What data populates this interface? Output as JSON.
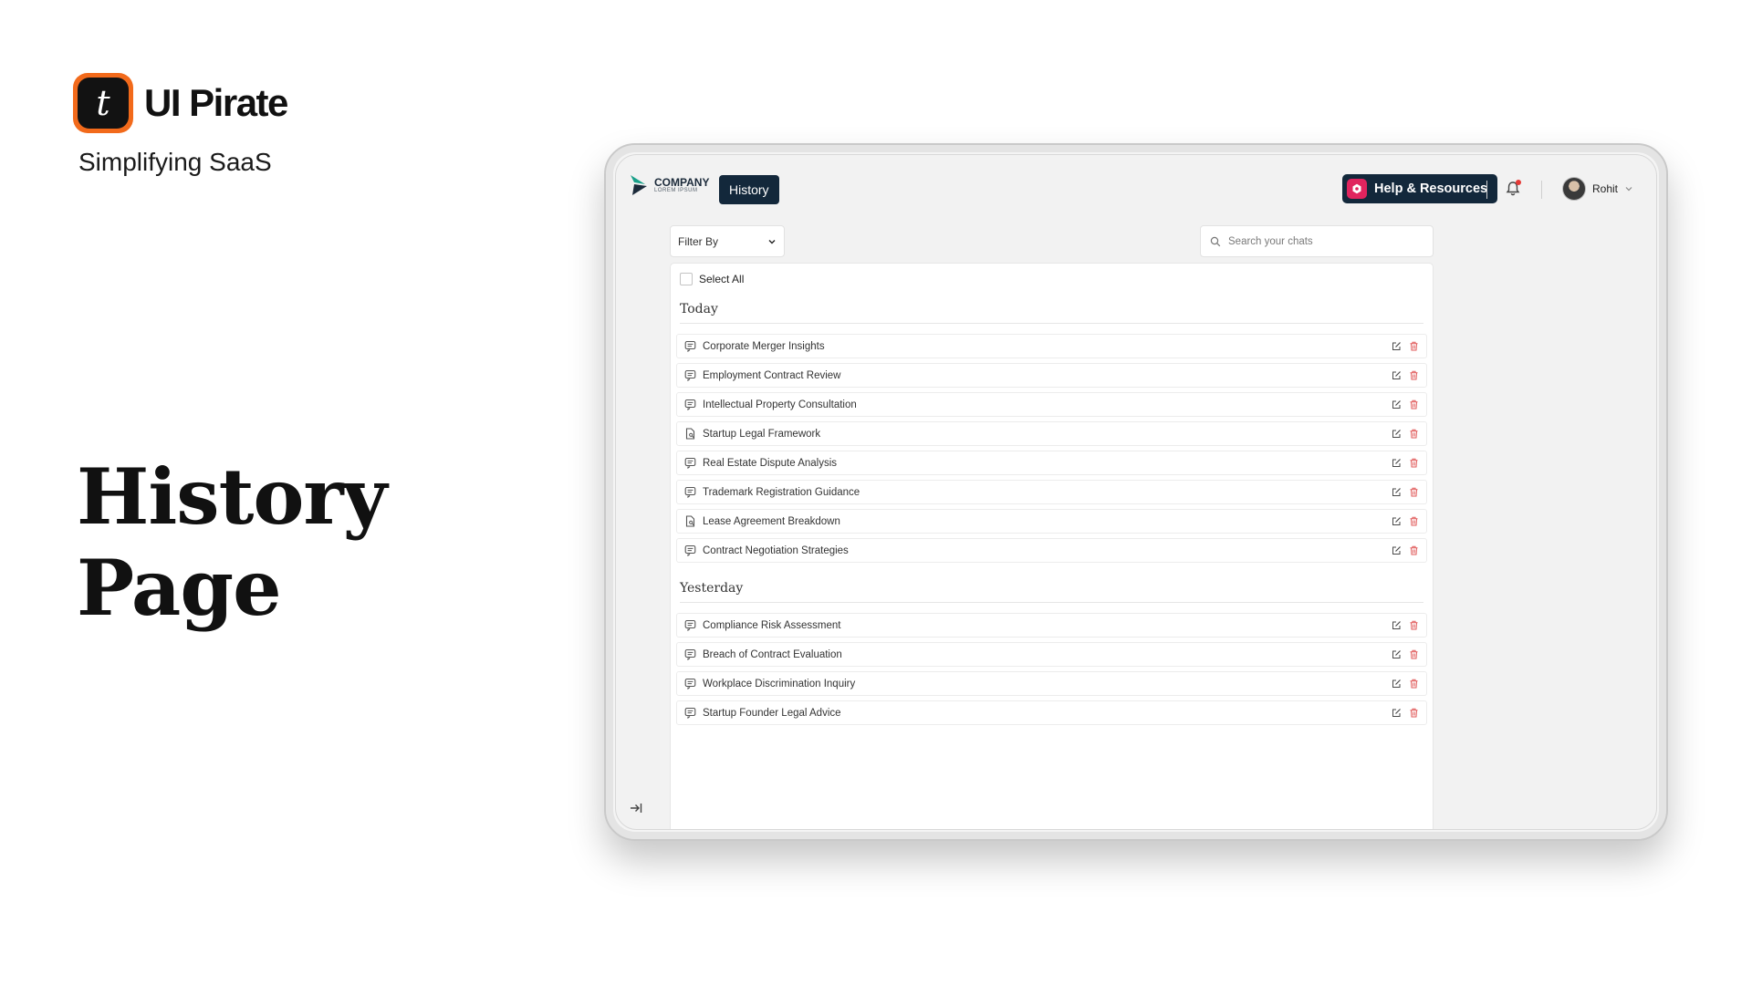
{
  "brand": {
    "name": "UI Pirate",
    "tagline": "Simplifying SaaS",
    "logo_glyph": "t",
    "logo_color": "#f26a1b"
  },
  "hero": {
    "line1": "History",
    "line2": "Page"
  },
  "app": {
    "company": {
      "name": "COMPANY",
      "sub": "LOREM IPSUM"
    },
    "nav_active": "History",
    "help_label": "Help & Resources",
    "user_name": "Rohit",
    "filter_label": "Filter By",
    "search_placeholder": "Search your chats",
    "select_all": "Select All",
    "groups": [
      {
        "title": "Today",
        "items": [
          {
            "label": "Corporate Merger Insights",
            "icon": "chat-icon"
          },
          {
            "label": "Employment Contract Review",
            "icon": "chat-icon"
          },
          {
            "label": "Intellectual Property Consultation",
            "icon": "chat-icon"
          },
          {
            "label": "Startup Legal Framework",
            "icon": "document-search-icon"
          },
          {
            "label": "Real Estate Dispute Analysis",
            "icon": "chat-icon"
          },
          {
            "label": "Trademark Registration Guidance",
            "icon": "chat-icon"
          },
          {
            "label": "Lease Agreement Breakdown",
            "icon": "document-search-icon"
          },
          {
            "label": "Contract Negotiation Strategies",
            "icon": "chat-icon"
          }
        ]
      },
      {
        "title": "Yesterday",
        "items": [
          {
            "label": "Compliance Risk Assessment",
            "icon": "chat-icon"
          },
          {
            "label": "Breach of Contract Evaluation",
            "icon": "chat-icon"
          },
          {
            "label": "Workplace Discrimination Inquiry",
            "icon": "chat-icon"
          },
          {
            "label": "Startup Founder Legal Advice",
            "icon": "chat-icon"
          }
        ]
      }
    ],
    "colors": {
      "navy": "#13283b",
      "help_accent": "#e0245e",
      "delete_red": "#e05a5a",
      "notification_dot": "#e53935"
    }
  }
}
